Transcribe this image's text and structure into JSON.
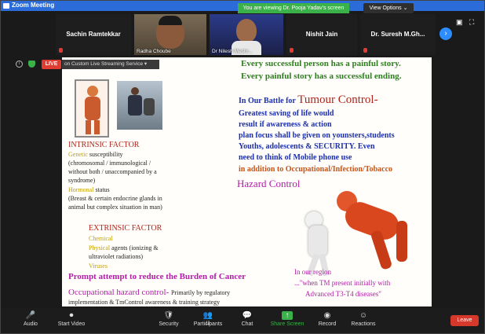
{
  "window": {
    "title": "Zoom Meeting"
  },
  "banner": {
    "text": "You are viewing Dr. Pooja Yadav's screen",
    "view_options": "View Options ⌄"
  },
  "participants": [
    {
      "name": "Sachin Ramtekkar",
      "video": false
    },
    {
      "name": "Radha Choube",
      "video": true
    },
    {
      "name": "Dr Nilesh Meshr...",
      "video": true
    },
    {
      "name": "Nishit Jain",
      "video": false
    },
    {
      "name": "Dr. Suresh M.Gh...",
      "video": false
    }
  ],
  "stream": {
    "live": "LIVE",
    "service": "on Custom Live Streaming Service ▾"
  },
  "slide": {
    "quote1": "Every successful person has a painful story.",
    "quote2": "Every painful story has a successful ending.",
    "battle_prefix": "In Our Battle for",
    "battle_big": "Tumour Control-",
    "body": [
      "Greatest saving of life would",
      "result if awareness & action",
      "plan focus shall be given on younsters,students",
      "Youths, adolescents & SECURITY. Even",
      "need to think of Mobile phone use"
    ],
    "occupational_line": "in addition to Occupational/Infection/Tobacco",
    "hazard": "Hazard Control",
    "intrinsic_title": "INTRINSIC FACTOR",
    "genetic_word": "Genetic",
    "genetic_rest": "susceptibility",
    "genetic_lines": [
      "(chromosomal / immunological /",
      "without both / unaccompanied by a",
      "syndrome)"
    ],
    "hormonal_word": "Hormonal",
    "hormonal_rest": "status",
    "hormonal_lines": [
      "(Breast & certain endocrine glands in",
      "animal but complex situation in man)"
    ],
    "extrinsic_title": "EXTRINSIC FACTOR",
    "chemical": "Chemical",
    "physical_word": "Physical",
    "physical_rest": "agents (ionizing &",
    "physical_line2": "ultraviolet radiations)",
    "viruses": "Viruses",
    "prompt": "Prompt attempt to reduce the Burden of",
    "cancer": "Cancer",
    "occ_title": "Occupational hazard control-",
    "occ_rest": "Primarily by regulatory",
    "occ_line2": "implementation & TmControl awareness & training strategy",
    "region_lines": [
      "In our region",
      "...\"when TM present initially with",
      "Advanced T3-T4 diseases\""
    ]
  },
  "toolbar": {
    "items": [
      {
        "label": "Audio",
        "icon": "🎤"
      },
      {
        "label": "Start Video",
        "icon": "⏺"
      },
      {
        "label": "Security",
        "icon": "🛡"
      },
      {
        "label": "Participants",
        "icon": "👥",
        "count": "11"
      },
      {
        "label": "Chat",
        "icon": "💬"
      },
      {
        "label": "Share Screen",
        "icon": "↑"
      },
      {
        "label": "Record",
        "icon": "◉"
      },
      {
        "label": "Reactions",
        "icon": "☺"
      }
    ],
    "leave": "Leave"
  },
  "colors": {
    "share_green": "#3bb14a",
    "leave_red": "#d7382c",
    "zoom_blue": "#2d8cff"
  }
}
